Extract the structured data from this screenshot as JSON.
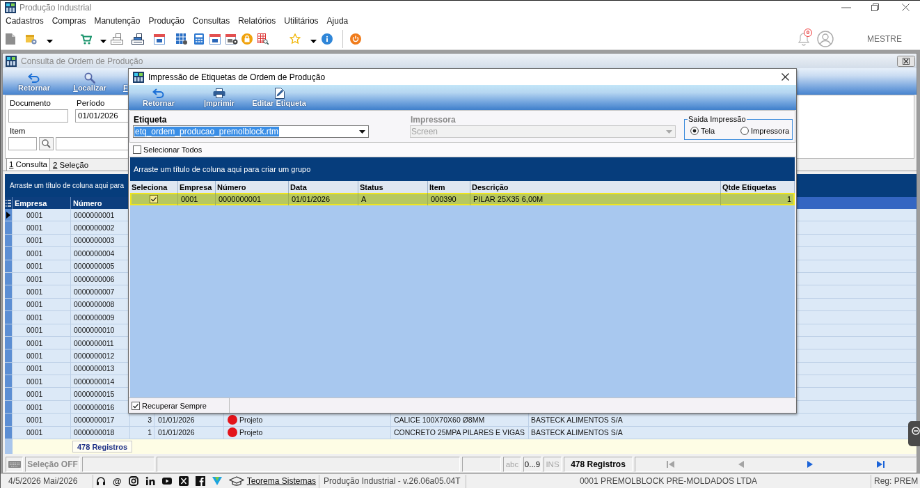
{
  "window": {
    "title": "Produção Industrial"
  },
  "menu": [
    "Cadastros",
    "Compras",
    "Manutenção",
    "Produção",
    "Consultas",
    "Relatórios",
    "Utilitários",
    "Ajuda"
  ],
  "toolbar": {
    "notifications": "0",
    "user": "MESTRE"
  },
  "consulta_window": {
    "title": "Consulta de Ordem de Produção",
    "toolbar": [
      {
        "kind": "back",
        "label": "Retornar",
        "mnemonic": false
      },
      {
        "kind": "search",
        "label": "Localizar",
        "mnemonic": true
      },
      {
        "label": "F",
        "mnemonic": true
      }
    ],
    "filters": {
      "documento": {
        "label": "Documento"
      },
      "periodo": {
        "label": "Período",
        "value": "01/01/2026"
      },
      "item": {
        "label": "Item"
      }
    },
    "tabs": [
      {
        "label": "1 Consulta",
        "selected": true,
        "mnemonic": true
      },
      {
        "label": "2 Seleção",
        "selected": false,
        "mnemonic": true
      }
    ],
    "group_panel": "Arraste um título de coluna aqui para",
    "table": {
      "columns": [
        "Empresa",
        "Número"
      ],
      "rows": [
        {
          "selected": true,
          "empresa": "0001",
          "numero": "0000000001"
        },
        {
          "selected": false,
          "empresa": "0001",
          "numero": "0000000002"
        },
        {
          "selected": false,
          "empresa": "0001",
          "numero": "0000000003"
        },
        {
          "selected": false,
          "empresa": "0001",
          "numero": "0000000004"
        },
        {
          "selected": false,
          "empresa": "0001",
          "numero": "0000000005"
        },
        {
          "selected": false,
          "empresa": "0001",
          "numero": "0000000006"
        },
        {
          "selected": false,
          "empresa": "0001",
          "numero": "0000000007"
        },
        {
          "selected": false,
          "empresa": "0001",
          "numero": "0000000008"
        },
        {
          "selected": false,
          "empresa": "0001",
          "numero": "0000000009"
        },
        {
          "selected": false,
          "empresa": "0001",
          "numero": "0000000010"
        },
        {
          "selected": false,
          "empresa": "0001",
          "numero": "0000000011"
        },
        {
          "selected": false,
          "empresa": "0001",
          "numero": "0000000012"
        },
        {
          "selected": false,
          "empresa": "0001",
          "numero": "0000000013"
        },
        {
          "selected": false,
          "empresa": "0001",
          "numero": "0000000014"
        },
        {
          "selected": false,
          "empresa": "0001",
          "numero": "0000000015"
        },
        {
          "selected": false,
          "empresa": "0001",
          "numero": "0000000016"
        },
        {
          "selected": false,
          "empresa": "0001",
          "numero": "0000000017",
          "column_3": "3",
          "column_4": "01/01/2026",
          "column_5": {
            "label": "Projeto",
            "color": "#e3141b"
          },
          "column_6": "CALICE 100X70X60 Ø8MM",
          "column_7": "BASTECK ALIMENTOS S/A"
        },
        {
          "selected": false,
          "empresa": "0001",
          "numero": "0000000018",
          "column_3": "1",
          "column_4": "01/01/2026",
          "column_5": {
            "label": "Projeto",
            "color": "#e3141b"
          },
          "column_6": "CONCRETO 25MPA PILARES E VIGAS",
          "column_7": "BASTECK ALIMENTOS S/A"
        }
      ]
    },
    "footer": "478 Registros",
    "status_bar": {
      "selection": "Seleção OFF",
      "modes": [
        {
          "label": "abc",
          "on": false
        },
        {
          "label": "0...9",
          "on": true
        },
        {
          "label": "INS",
          "on": false
        }
      ],
      "records": "478 Registros",
      "nav": [
        {
          "kind": "first",
          "disabled": true
        },
        {
          "kind": "prev",
          "disabled": true
        },
        {
          "kind": "next",
          "disabled": false
        },
        {
          "kind": "last",
          "disabled": false
        }
      ]
    }
  },
  "print_dialog": {
    "title": "Impressão de Etiquetas de Ordem de Produção",
    "toolbar": [
      {
        "kind": "back",
        "label": "Retornar",
        "mnemonic": false
      },
      {
        "kind": "print",
        "label": "Imprimir",
        "mnemonic": true
      },
      {
        "kind": "edit",
        "label": "Editar Etiqueta",
        "mnemonic": false
      }
    ],
    "etiqueta": {
      "label": "Etiqueta",
      "value": "etq_ordem_producao_premolblock.rtm",
      "highlighted": true
    },
    "impressora": {
      "label": "Impressora",
      "value": "Screen",
      "disabled": true
    },
    "saida": {
      "title": "Saida Impressão",
      "options": [
        {
          "label": "Tela",
          "selected": true
        },
        {
          "label": "Impressora",
          "selected": false
        }
      ]
    },
    "select_all": {
      "label": "Selecionar Todos",
      "checked": false
    },
    "group_panel": "Arraste um título de coluna aqui para criar um grupo",
    "table": {
      "selection_column": "Seleciona",
      "columns": [
        "Empresa",
        "Número",
        "Data",
        "Status",
        "Item",
        "Descrição",
        "Qtde Etiquetas"
      ],
      "rows": [
        {
          "selected": true,
          "checked": true,
          "cells": [
            "0001",
            "0000000001",
            "01/01/2026",
            "A",
            "000390",
            "PILAR 25X35 6,00M",
            "1"
          ]
        }
      ]
    },
    "recover_always": {
      "label": "Recuperar Sempre",
      "checked": true
    }
  },
  "status_bar": {
    "date": "4/5/2026 Mai/2026",
    "email": "@",
    "link": "Teorema Sistemas",
    "version": "Produção Industrial - v.26.06a05.04T",
    "company": "0001 PREMOLBLOCK PRE-MOLDADOS LTDA",
    "reg": "Reg: PREM"
  }
}
